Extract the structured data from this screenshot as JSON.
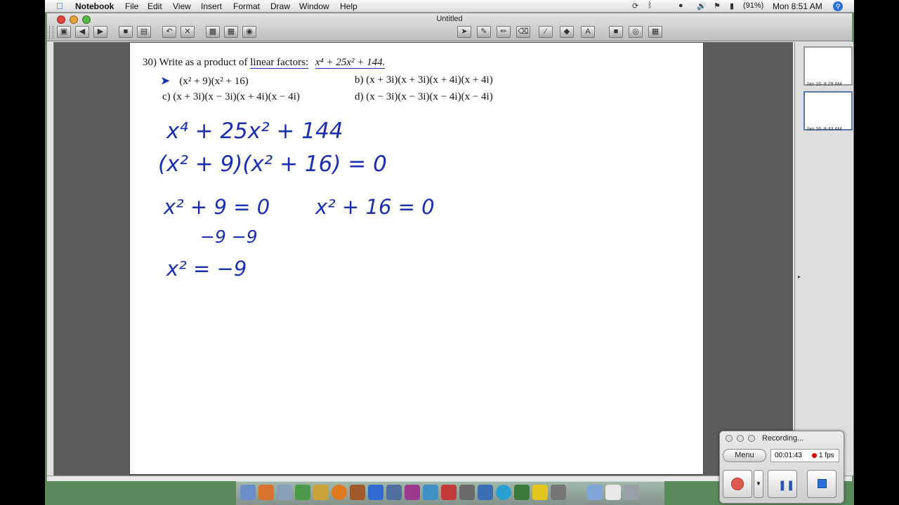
{
  "menubar": {
    "app_name": "Notebook",
    "items": [
      "File",
      "Edit",
      "View",
      "Insert",
      "Format",
      "Draw",
      "Window",
      "Help"
    ],
    "battery": "(91%)",
    "clock": "Mon 8:51 AM"
  },
  "window": {
    "title": "Untitled"
  },
  "question": {
    "number": "30)",
    "prompt": "Write as a product of",
    "prompt_underlined": "linear factors:",
    "expression": "x⁴ + 25x² + 144.",
    "option_a": "(x² + 9)(x² + 16)",
    "option_b": "b)  (x + 3i)(x + 3i)(x + 4i)(x + 4i)",
    "option_c": "c)  (x + 3i)(x − 3i)(x + 4i)(x − 4i)",
    "option_d": "d)  (x − 3i)(x − 3i)(x − 4i)(x − 4i)"
  },
  "handwriting": {
    "line1": "x⁴ + 25x² + 144",
    "line2": "(x² + 9)(x² + 16) = 0",
    "line3_left": "x² + 9 = 0",
    "line3_right": "x² + 16 = 0",
    "line4": "−9  −9",
    "line5": "x² = −9"
  },
  "sidepanel": {
    "thumb1_label": "Jan 16–8:29 AM",
    "thumb2_label": "Jan 16–8:43 AM"
  },
  "recorder": {
    "title": "Recording...",
    "menu_label": "Menu",
    "time": "00:01:43",
    "fps": "1 fps"
  },
  "colors": {
    "ink": "#1a2fb0",
    "record_red": "#d00000",
    "dock_blue": "#2e6bd0"
  }
}
